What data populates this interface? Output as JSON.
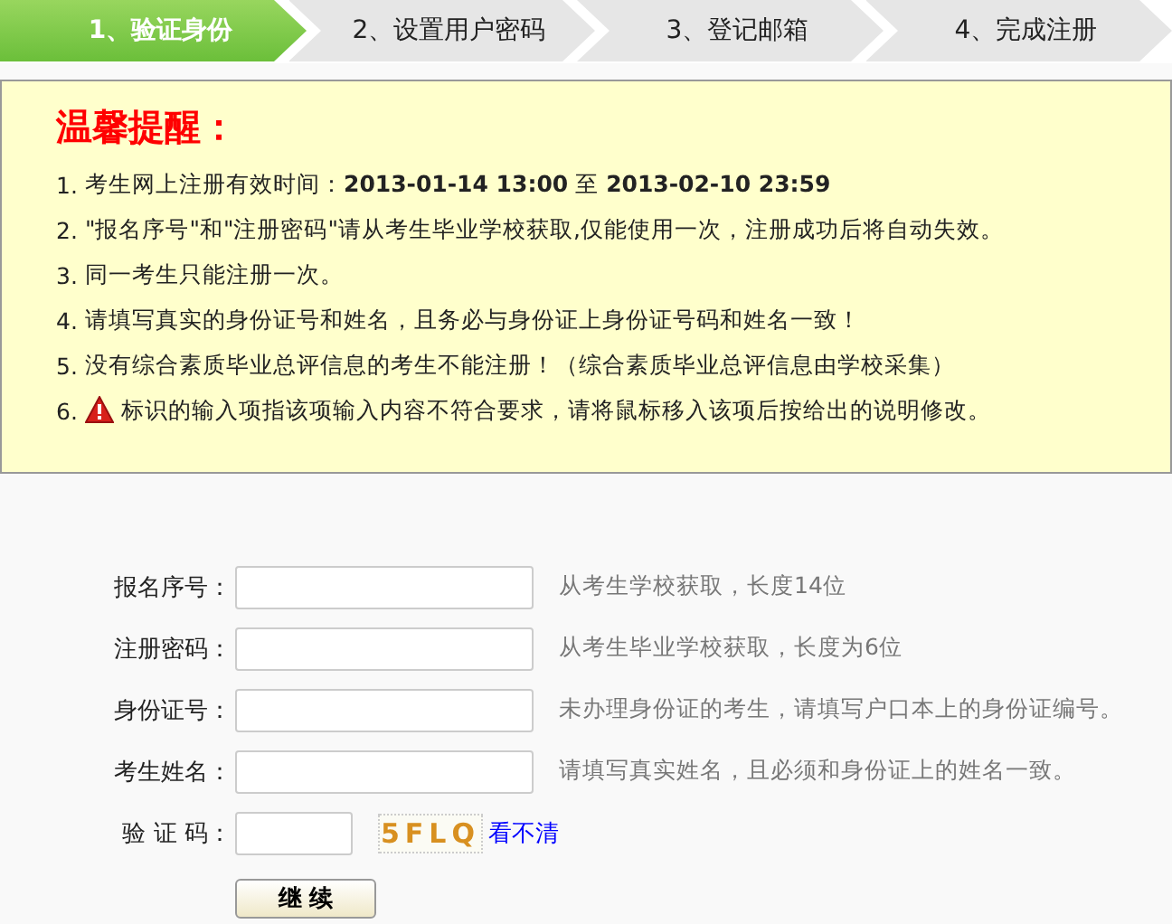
{
  "steps": [
    {
      "label": "1、验证身份",
      "selected": true
    },
    {
      "label": "2、设置用户密码",
      "selected": false
    },
    {
      "label": "3、登记邮箱",
      "selected": false
    },
    {
      "label": "4、完成注册",
      "selected": false
    }
  ],
  "notice": {
    "title": "温馨提醒：",
    "items": [
      {
        "number": "1.",
        "text": "考生网上注册有效时间：**2013-01-14 13:00** 至 **2013-02-10 23:59**"
      },
      {
        "number": "2.",
        "text": "\"报名序号\"和\"注册密码\"请从考生毕业学校获取,仅能使用一次，注册成功后将自动失效。"
      },
      {
        "number": "3.",
        "text": "同一考生只能注册一次。"
      },
      {
        "number": "4.",
        "text": "请填写真实的身份证号和姓名，且务必与身份证上身份证号码和姓名一致！"
      },
      {
        "number": "5.",
        "text": "没有综合素质毕业总评信息的考生不能注册！（综合素质毕业总评信息由学校采集）"
      },
      {
        "number": "6.",
        "kind": "warning",
        "text": "标识的输入项指该项输入内容不符合要求，请将鼠标移入该项后按给出的说明修改。"
      }
    ]
  },
  "form": {
    "fields": [
      {
        "label": "报名序号：",
        "hint": "从考生学校获取，长度14位"
      },
      {
        "label": "注册密码：",
        "hint": "从考生毕业学校获取，长度为6位"
      },
      {
        "label": "身份证号：",
        "hint": "未办理身份证的考生，请填写户口本上的身份证编号。"
      },
      {
        "label": "考生姓名：",
        "hint": "请填写真实姓名，且必须和身份证上的姓名一致。"
      }
    ],
    "captcha": {
      "label": "验 证 码：",
      "code": "5FLQ",
      "refresh_link": "看不清"
    },
    "submit": "继 续"
  }
}
